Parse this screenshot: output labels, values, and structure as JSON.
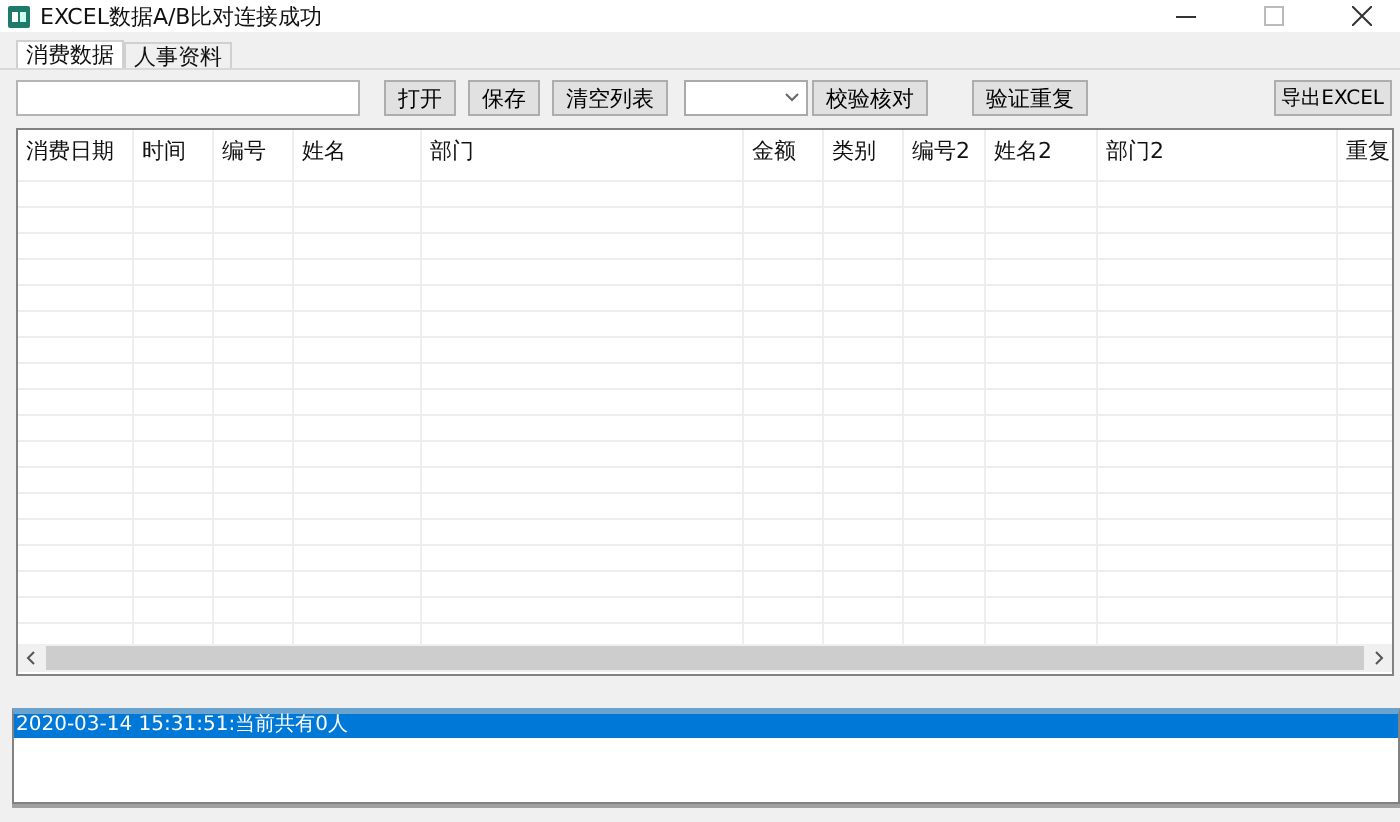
{
  "window": {
    "title": "EXCEL数据A/B比对连接成功"
  },
  "tabs": [
    {
      "label": "消费数据",
      "selected": true
    },
    {
      "label": "人事资料",
      "selected": false
    }
  ],
  "toolbar": {
    "buttons": [
      "打开",
      "保存",
      "清空列表"
    ],
    "check_button": "校验核对",
    "verify_button": "验证重复",
    "export_button": "导出EXCEL"
  },
  "table": {
    "columns": [
      "消费日期",
      "时间",
      "编号",
      "姓名",
      "部门",
      "金额",
      "类别",
      "编号2",
      "姓名2",
      "部门2",
      "重复"
    ]
  },
  "log": {
    "items": [
      {
        "text": "2020-03-14 15:31:51:当前共有0人",
        "selected": true
      }
    ]
  }
}
